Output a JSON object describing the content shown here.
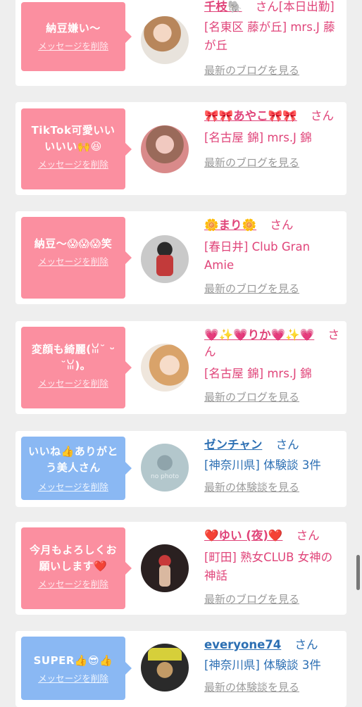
{
  "cards": [
    {
      "theme": "pink",
      "message": "納豆嫌い〜",
      "delete": "メッセージを削除",
      "name": "千枝🐘",
      "san": "さん",
      "name_suffix": "[本日出勤]",
      "location": "[名東区 藤が丘] mrs.J 藤が丘",
      "link": "最新のブログを見る"
    },
    {
      "theme": "pink",
      "message": "TikTok可愛いいいいい🙌😆",
      "delete": "メッセージを削除",
      "name": "🎀🎀あやこ🎀🎀",
      "san": "さん",
      "location": "[名古屋 錦] mrs.J 錦",
      "link": "最新のブログを見る"
    },
    {
      "theme": "pink",
      "message": "納豆〜😱😱😱笑",
      "delete": "メッセージを削除",
      "name": "🌼まり🌼",
      "san": "さん",
      "location": "[春日井] Club Gran Amie",
      "link": "最新のブログを見る"
    },
    {
      "theme": "pink",
      "message": "変顔も綺麗(ꈍ˘ ᵕ ˘ꈍ)｡",
      "delete": "メッセージを削除",
      "name": "💗✨💗りか💗✨💗",
      "san": "さん",
      "location": "[名古屋 錦] mrs.J 錦",
      "link": "最新のブログを見る"
    },
    {
      "theme": "blue",
      "message": "いいね👍ありがとう美人さん",
      "delete": "メッセージを削除",
      "name": "ゼンチャン",
      "san": "さん",
      "location": "[神奈川県] 体験談 3件",
      "link": "最新の体験談を見る",
      "avatar_text": "no photo"
    },
    {
      "theme": "pink",
      "message": "今月もよろしくお願いします❤️",
      "delete": "メッセージを削除",
      "name": "❤️ゆい (夜)❤️",
      "san": "さん",
      "location": "[町田] 熟女CLUB 女神の神話",
      "link": "最新のブログを見る"
    },
    {
      "theme": "blue",
      "message": "SUPER👍😎👍",
      "delete": "メッセージを削除",
      "name": "everyone74",
      "san": "さん",
      "location": "[神奈川県] 体験談 3件",
      "link": "最新の体験談を見る"
    }
  ],
  "colors": {
    "pink_bubble": "#fb8fa0",
    "blue_bubble": "#8ab8f3",
    "pink_text": "#e0457a",
    "blue_text": "#2c6fb3"
  }
}
